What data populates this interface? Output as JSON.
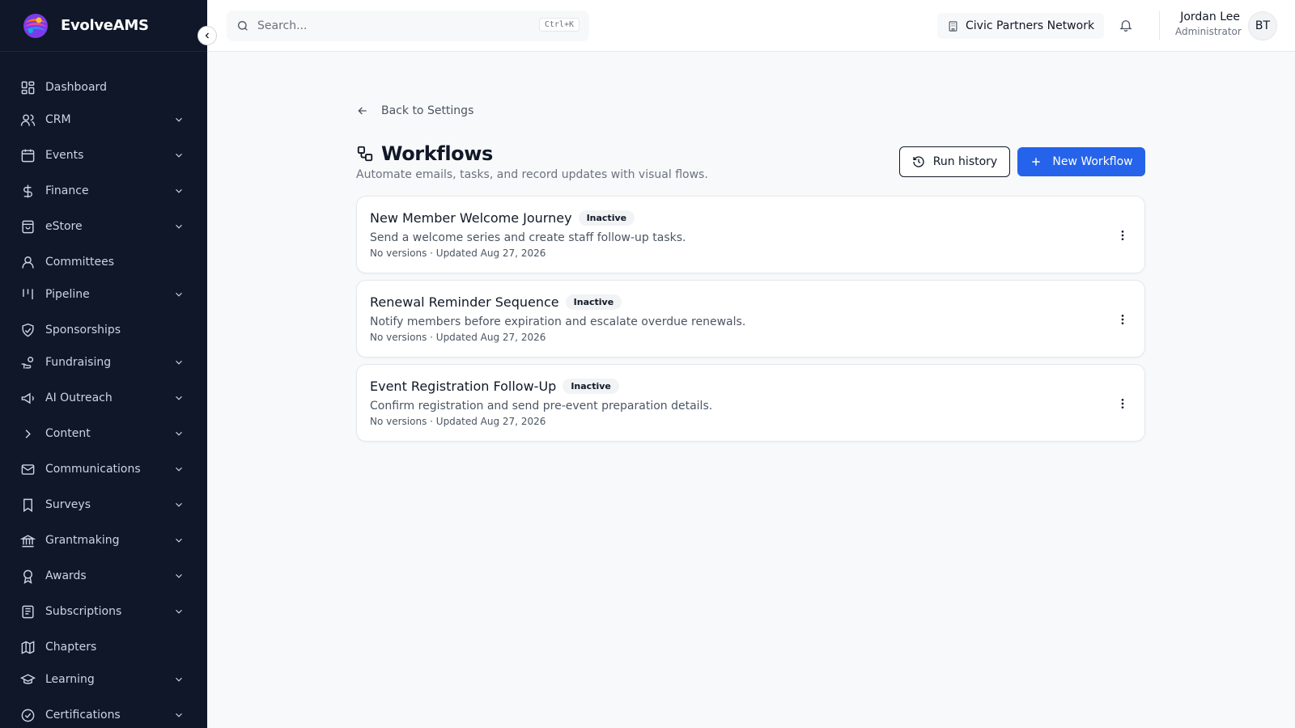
{
  "brand": {
    "name": "EvolveAMS"
  },
  "sidebar": {
    "items": [
      {
        "label": "Dashboard",
        "icon": "dashboard-grid-icon",
        "has_submenu": false
      },
      {
        "label": "CRM",
        "icon": "users-icon",
        "has_submenu": true
      },
      {
        "label": "Events",
        "icon": "calendar-icon",
        "has_submenu": true
      },
      {
        "label": "Finance",
        "icon": "dollar-icon",
        "has_submenu": true
      },
      {
        "label": "eStore",
        "icon": "shopping-bag-icon",
        "has_submenu": true
      },
      {
        "label": "Committees",
        "icon": "user-icon",
        "has_submenu": false
      },
      {
        "label": "Pipeline",
        "icon": "kanban-icon",
        "has_submenu": true
      },
      {
        "label": "Sponsorships",
        "icon": "handshake-icon",
        "has_submenu": false
      },
      {
        "label": "Fundraising",
        "icon": "hand-coins-icon",
        "has_submenu": true
      },
      {
        "label": "AI Outreach",
        "icon": "megaphone-icon",
        "has_submenu": true
      },
      {
        "label": "Content",
        "icon": "chevron-right-icon",
        "has_submenu": true
      },
      {
        "label": "Communications",
        "icon": "mail-icon",
        "has_submenu": true
      },
      {
        "label": "Surveys",
        "icon": "bookmark-icon",
        "has_submenu": true
      },
      {
        "label": "Grantmaking",
        "icon": "landmark-icon",
        "has_submenu": true
      },
      {
        "label": "Awards",
        "icon": "award-icon",
        "has_submenu": true
      },
      {
        "label": "Subscriptions",
        "icon": "newspaper-icon",
        "has_submenu": true
      },
      {
        "label": "Chapters",
        "icon": "map-icon",
        "has_submenu": false
      },
      {
        "label": "Learning",
        "icon": "graduation-cap-icon",
        "has_submenu": true
      },
      {
        "label": "Certifications",
        "icon": "badge-check-icon",
        "has_submenu": true
      }
    ]
  },
  "topbar": {
    "search_placeholder": "Search...",
    "search_shortcut": "Ctrl+K",
    "organization": "Civic Partners Network",
    "user_name": "Jordan Lee",
    "user_role": "Administrator",
    "avatar_initials": "BT"
  },
  "main": {
    "back_label": "Back to Settings",
    "title": "Workflows",
    "subtitle": "Automate emails, tasks, and record updates with visual flows.",
    "run_history_label": "Run history",
    "new_workflow_label": "New Workflow",
    "workflows": [
      {
        "name": "New Member Welcome Journey",
        "status": "Inactive",
        "description": "Send a welcome series and create staff follow-up tasks.",
        "meta": "No versions · Updated Aug 27, 2026"
      },
      {
        "name": "Renewal Reminder Sequence",
        "status": "Inactive",
        "description": "Notify members before expiration and escalate overdue renewals.",
        "meta": "No versions · Updated Aug 27, 2026"
      },
      {
        "name": "Event Registration Follow-Up",
        "status": "Inactive",
        "description": "Confirm registration and send pre-event preparation details.",
        "meta": "No versions · Updated Aug 27, 2026"
      }
    ]
  },
  "colors": {
    "sidebar_bg": "#0f1729",
    "primary": "#2563eb",
    "page_bg": "#f8f9fa"
  }
}
